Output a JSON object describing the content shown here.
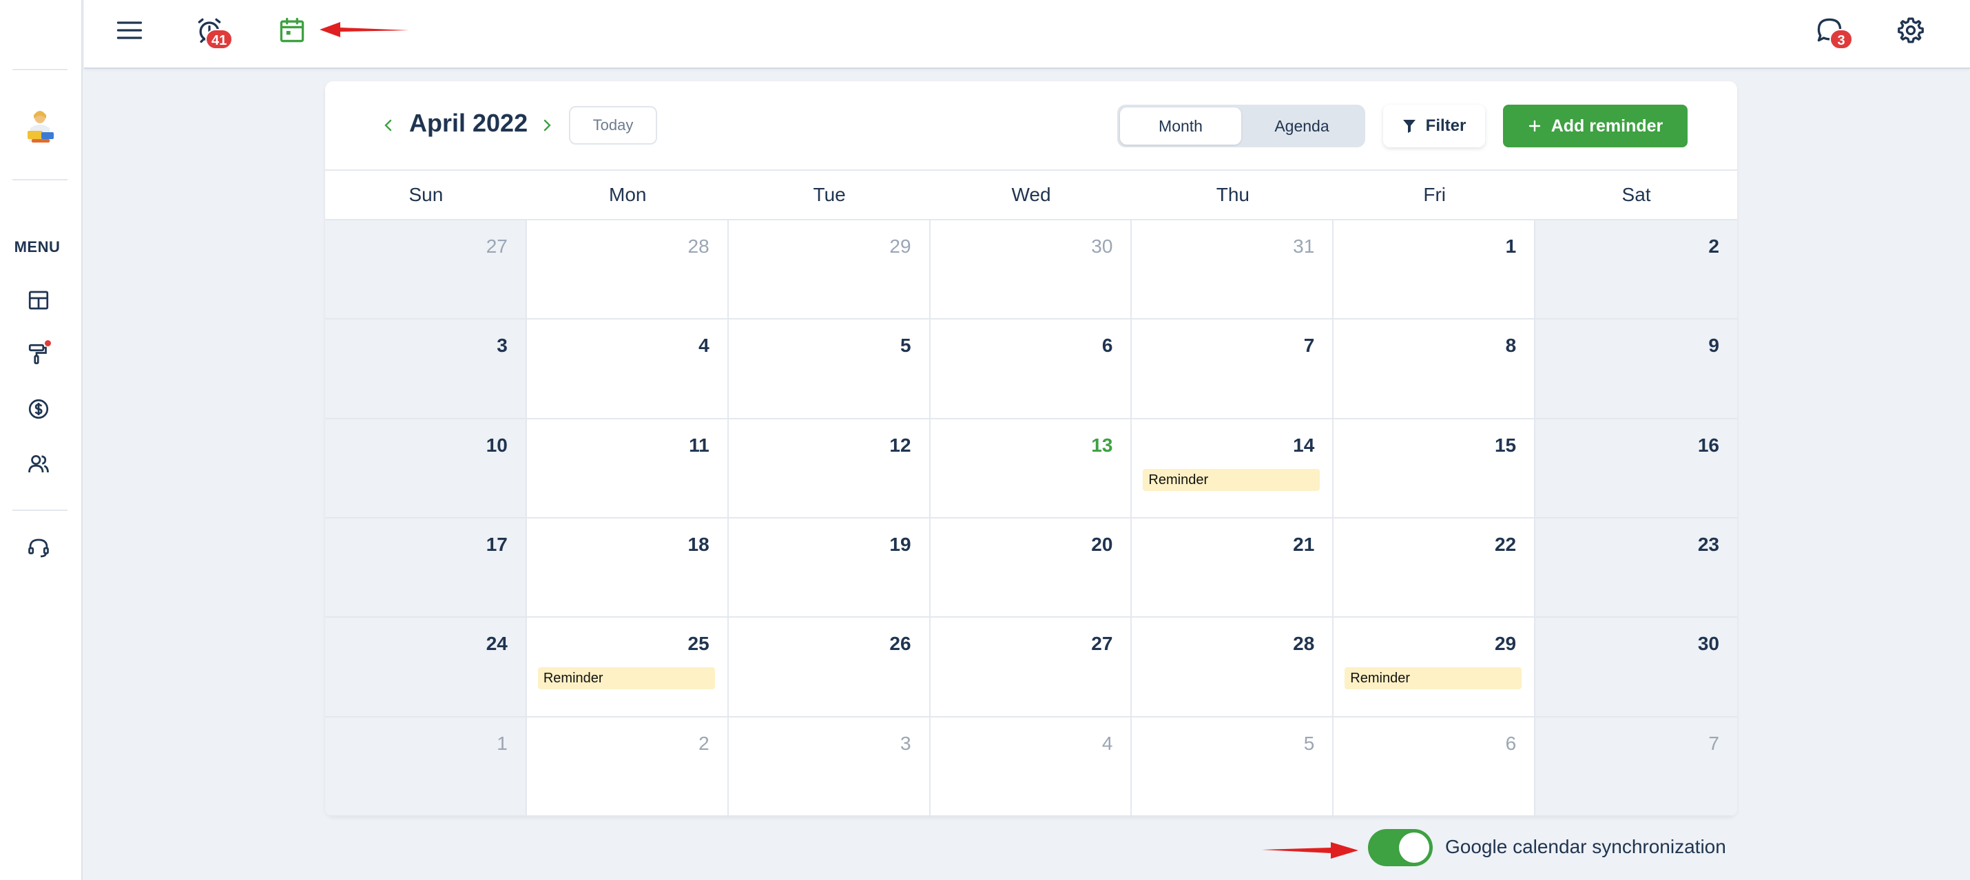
{
  "sidebar": {
    "menu_label": "MENU",
    "items": [
      {
        "icon": "dashboard-icon"
      },
      {
        "icon": "paint-roller-icon",
        "has_notification_dot": true
      },
      {
        "icon": "dollar-circle-icon"
      },
      {
        "icon": "users-icon"
      },
      {
        "icon": "headset-icon"
      }
    ]
  },
  "topbar": {
    "alarm_badge": "41",
    "chat_badge": "3",
    "icons": [
      "hamburger-menu-icon",
      "alarm-clock-icon",
      "calendar-icon",
      "chat-bubble-icon",
      "gear-icon"
    ]
  },
  "calendar": {
    "title": "April 2022",
    "today_label": "Today",
    "views": [
      "Month",
      "Agenda"
    ],
    "active_view": "Month",
    "filter_label": "Filter",
    "add_label": "Add reminder",
    "weekdays": [
      "Sun",
      "Mon",
      "Tue",
      "Wed",
      "Thu",
      "Fri",
      "Sat"
    ],
    "days": [
      {
        "d": "27",
        "muted": true
      },
      {
        "d": "28",
        "muted": true
      },
      {
        "d": "29",
        "muted": true
      },
      {
        "d": "30",
        "muted": true
      },
      {
        "d": "31",
        "muted": true
      },
      {
        "d": "1"
      },
      {
        "d": "2"
      },
      {
        "d": "3"
      },
      {
        "d": "4"
      },
      {
        "d": "5"
      },
      {
        "d": "6"
      },
      {
        "d": "7"
      },
      {
        "d": "8"
      },
      {
        "d": "9"
      },
      {
        "d": "10"
      },
      {
        "d": "11"
      },
      {
        "d": "12"
      },
      {
        "d": "13",
        "today": true
      },
      {
        "d": "14",
        "event": "Reminder"
      },
      {
        "d": "15"
      },
      {
        "d": "16"
      },
      {
        "d": "17"
      },
      {
        "d": "18"
      },
      {
        "d": "19"
      },
      {
        "d": "20"
      },
      {
        "d": "21"
      },
      {
        "d": "22"
      },
      {
        "d": "23"
      },
      {
        "d": "24"
      },
      {
        "d": "25",
        "event": "Reminder"
      },
      {
        "d": "26"
      },
      {
        "d": "27"
      },
      {
        "d": "28"
      },
      {
        "d": "29",
        "event": "Reminder"
      },
      {
        "d": "30"
      },
      {
        "d": "1",
        "muted": true
      },
      {
        "d": "2",
        "muted": true
      },
      {
        "d": "3",
        "muted": true
      },
      {
        "d": "4",
        "muted": true
      },
      {
        "d": "5",
        "muted": true
      },
      {
        "d": "6",
        "muted": true
      },
      {
        "d": "7",
        "muted": true
      }
    ]
  },
  "sync": {
    "label": "Google calendar synchronization",
    "enabled": true
  },
  "colors": {
    "accent": "#3ea142",
    "text": "#1f3450",
    "event_bg": "#fdf1c5",
    "badge": "#df3b3b",
    "annotation_arrow": "#e02020"
  }
}
